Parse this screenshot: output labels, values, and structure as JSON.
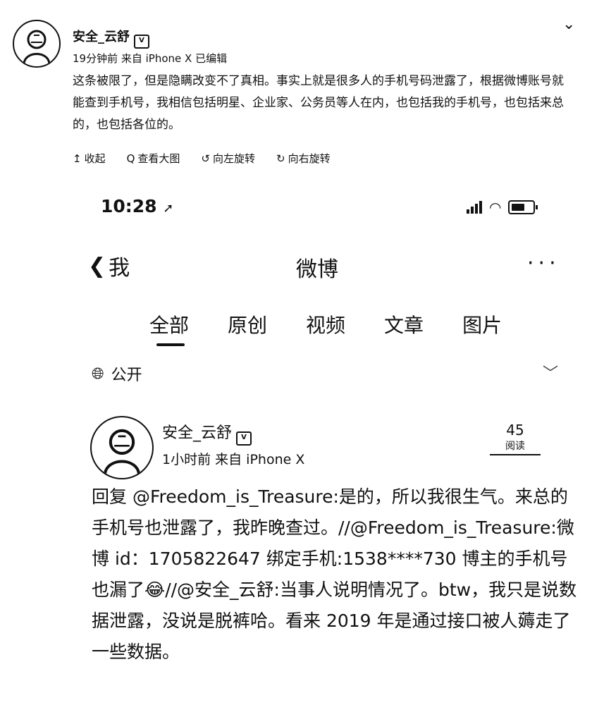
{
  "outer_post": {
    "author": "安全_云舒",
    "meta": "19分钟前 来自 iPhone X  已编辑",
    "text": "这条被限了，但是隐瞒改变不了真相。事实上就是很多人的手机号码泄露了，根据微博账号就能查到手机号，我相信包括明星、企业家、公务员等人在内，也包括我的手机号，也包括来总的，也包括各位的。",
    "actions": [
      {
        "icon": "collapse-up-icon",
        "glyph": "↥",
        "label": "收起"
      },
      {
        "icon": "magnifier-icon",
        "glyph": "Q",
        "label": "查看大图"
      },
      {
        "icon": "rotate-left-icon",
        "glyph": "↺",
        "label": "向左旋转"
      },
      {
        "icon": "rotate-right-icon",
        "glyph": "↻",
        "label": "向右旋转"
      }
    ]
  },
  "embedded": {
    "status_bar": {
      "time": "10:28"
    },
    "nav": {
      "back_label": "我",
      "title": "微博",
      "more": "···"
    },
    "tabs": [
      "全部",
      "原创",
      "视频",
      "文章",
      "图片"
    ],
    "visibility": "公开",
    "post": {
      "author": "安全_云舒",
      "meta": "1小时前  来自 iPhone X",
      "reads_count": "45",
      "reads_label": "阅读",
      "text": "回复 @Freedom_is_Treasure:是的，所以我很生气。来总的手机号也泄露了，我昨晚查过。//@Freedom_is_Treasure:微博 id：1705822647 绑定手机:1538****730 博主的手机号也漏了😂//@安全_云舒:当事人说明情况了。btw，我只是说数据泄露，没说是脱裤哈。看来 2019 年是通过接口被人薅走了一些数据。"
    }
  }
}
